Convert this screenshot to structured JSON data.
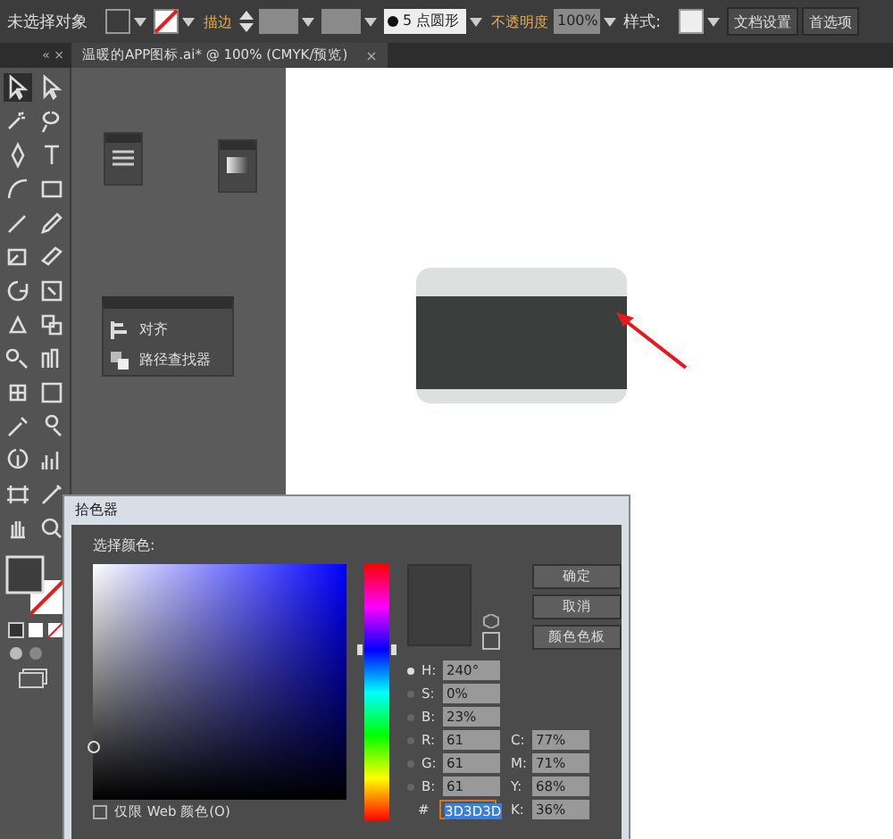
{
  "control_bar": [
    {
      "kind": "label",
      "text": "未选择对象"
    },
    {
      "kind": "fill-swatch"
    },
    {
      "kind": "stroke-swatch"
    },
    {
      "kind": "link",
      "text": "描边"
    },
    {
      "kind": "stepper"
    },
    {
      "kind": "field"
    },
    {
      "kind": "field"
    },
    {
      "kind": "brush",
      "text": "5 点圆形"
    },
    {
      "kind": "link",
      "text": "不透明度"
    },
    {
      "kind": "field",
      "text": "100%"
    },
    {
      "kind": "label",
      "text": "样式:"
    },
    {
      "kind": "style-swatch"
    },
    {
      "kind": "button",
      "text": "文档设置"
    },
    {
      "kind": "button",
      "text": "首选项"
    }
  ],
  "document_tab": {
    "title": "温暖的APP图标.ai* @ 100% (CMYK/预览)",
    "close": "×",
    "panel_controls": "« ×"
  },
  "tools": [
    {
      "selected": true
    },
    {
      "selected": false
    },
    {
      "selected": false
    },
    {
      "selected": false
    },
    {
      "selected": false
    },
    {
      "selected": false
    },
    {
      "selected": false
    },
    {
      "selected": false
    },
    {
      "selected": false
    },
    {
      "selected": false
    },
    {
      "selected": false
    },
    {
      "selected": false
    },
    {
      "selected": false
    },
    {
      "selected": false
    },
    {
      "selected": false
    },
    {
      "selected": false
    },
    {
      "selected": false
    },
    {
      "selected": false
    },
    {
      "selected": false
    },
    {
      "selected": false
    },
    {
      "selected": false
    },
    {
      "selected": false
    },
    {
      "selected": false
    },
    {
      "selected": false
    },
    {
      "selected": false
    },
    {
      "selected": false
    },
    {
      "selected": false
    },
    {
      "selected": false
    }
  ],
  "floating_panel": {
    "items": [
      {
        "label": "对齐"
      },
      {
        "label": "路径查找器"
      }
    ]
  },
  "color_picker": {
    "title": "拾色器",
    "prompt": "选择颜色:",
    "hue_slider": {
      "level": 0.67
    },
    "buttons": [
      "确定",
      "取消",
      "颜色色板"
    ],
    "fields": [
      {
        "kind": "radio",
        "label": "H:",
        "value": "240°",
        "selected": true
      },
      {
        "kind": "radio",
        "label": "S:",
        "value": "0%",
        "selected": false
      },
      {
        "kind": "radio",
        "label": "B:",
        "value": "23%",
        "selected": false
      },
      {
        "kind": "radio",
        "label": "R:",
        "value": "61",
        "selected": false
      },
      {
        "kind": "radio",
        "label": "G:",
        "value": "61",
        "selected": false
      },
      {
        "kind": "radio",
        "label": "B:",
        "value": "61",
        "selected": false
      }
    ],
    "cmyk": [
      {
        "label": "C:",
        "value": "77%"
      },
      {
        "label": "M:",
        "value": "71%"
      },
      {
        "label": "Y:",
        "value": "68%"
      },
      {
        "label": "K:",
        "value": "36%"
      }
    ],
    "hex": {
      "label": "#",
      "value": "3D3D3D"
    },
    "web_only": {
      "label": "仅限 Web 颜色(O)",
      "checked": false
    }
  }
}
